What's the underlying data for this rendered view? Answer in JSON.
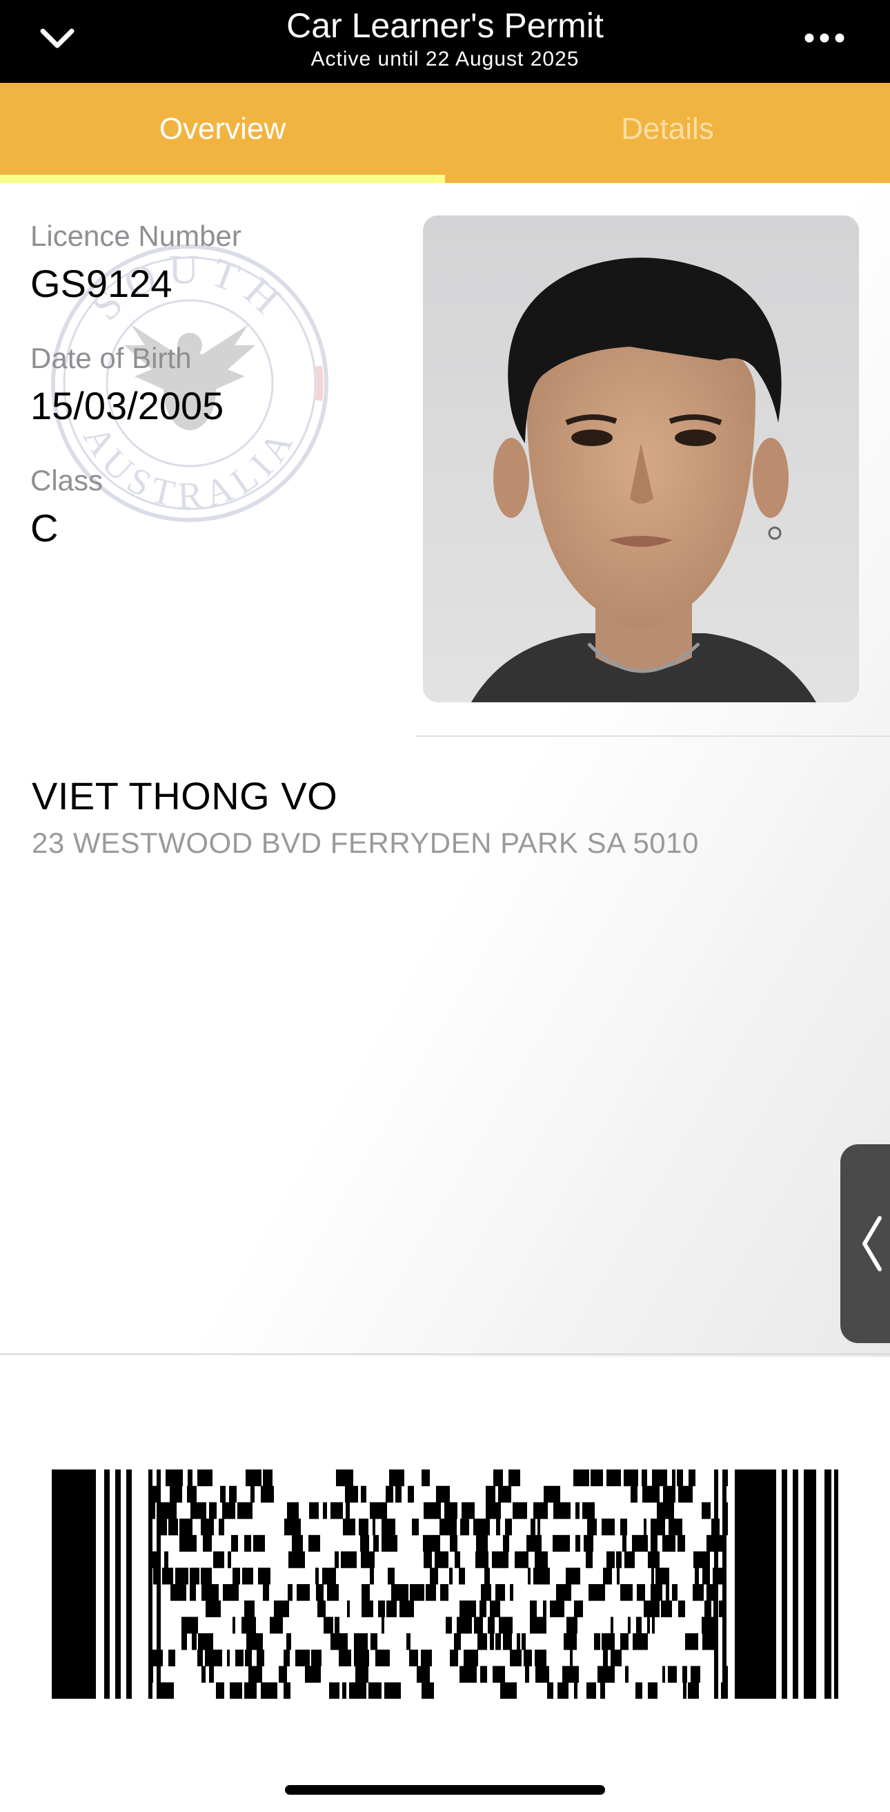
{
  "header": {
    "title": "Car Learner's Permit",
    "subtitle": "Active until 22 August 2025",
    "back_icon": "chevron-down-icon",
    "more_icon": "ellipsis-icon"
  },
  "tabs": [
    {
      "label": "Overview",
      "active": true
    },
    {
      "label": "Details",
      "active": false
    }
  ],
  "colors": {
    "header_bg": "#000000",
    "tab_bg": "#f2b440",
    "tab_indicator": "#f7ff8a",
    "label_gray": "#8e8e93"
  },
  "fields": {
    "licence_number": {
      "label": "Licence Number",
      "value": "GS9124"
    },
    "date_of_birth": {
      "label": "Date of Birth",
      "value": "15/03/2005"
    },
    "class": {
      "label": "Class",
      "value": "C"
    }
  },
  "watermark": {
    "text_top": "SOUTH",
    "text_bottom": "AUSTRALIA",
    "icon": "piping-shrike-seal-icon"
  },
  "holder": {
    "name": "VIET THONG VO",
    "address": "23 WESTWOOD BVD FERRYDEN PARK SA 5010"
  },
  "side_handle_icon": "chevron-left-icon",
  "barcode_icon": "pdf417-barcode"
}
